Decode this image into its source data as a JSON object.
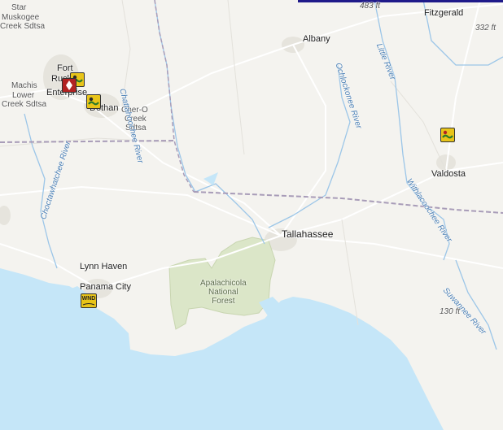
{
  "map": {
    "cities": {
      "star": "Star",
      "muskogee": "Muskogee",
      "creek_sdtsa": "Creek Sdtsa",
      "fort": "Fort",
      "rucker": "Rucker",
      "machis": "Machis",
      "lower": "Lower",
      "creek_sdtsa2": "Creek Sdtsa",
      "enterprise": "Enterprise",
      "dothan": "Dothan",
      "cher_o": "Cher-O",
      "creek": "Creek",
      "sdtsa": "Sdtsa",
      "albany": "Albany",
      "fitzgerald": "Fitzgerald",
      "valdosta": "Valdosta",
      "tallahassee": "Tallahassee",
      "lynn_haven": "Lynn Haven",
      "panama_city": "Panama City"
    },
    "park": {
      "line1": "Apalachicola",
      "line2": "National",
      "line3": "Forest"
    },
    "rivers": {
      "chattahoochee": "Chattahoochee River",
      "ochlockonee": "Ochlockonee River",
      "little": "Little River",
      "choctawhatchee": "Choctawhatchee River",
      "withlacoochee": "Withlacoochee River",
      "suwannee": "Suwannee River"
    },
    "elevations": {
      "e483": "483 ft",
      "e332": "332 ft",
      "e130": "130 ft"
    },
    "markers": {
      "wnd": "WND"
    },
    "colors": {
      "land": "#f4f3ef",
      "water": "#c5e6f8",
      "forest": "#dbe6c8",
      "state_border": "#a89cb8",
      "river": "#9cc6e8",
      "road": "#ffffff",
      "warning_red": "#b22222",
      "advisory_yellow": "#e8c419",
      "topbar": "#1f1a8a"
    }
  }
}
